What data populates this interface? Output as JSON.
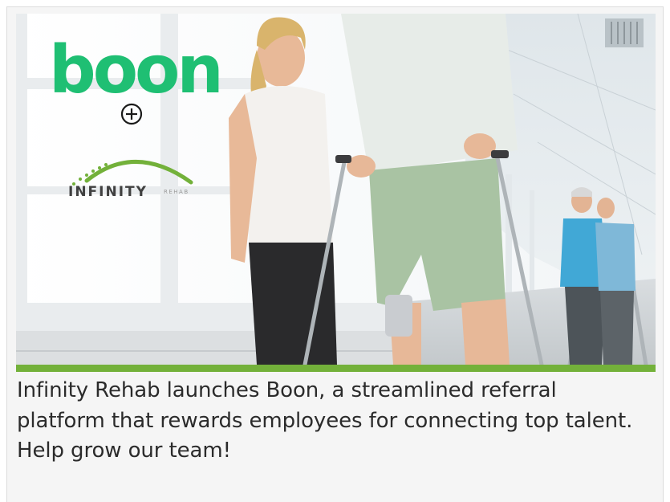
{
  "logo": {
    "brand": "boon",
    "partner_name": "INFINITY",
    "partner_sub": "REHAB"
  },
  "photo": {
    "description_icon": "rehab-walkway-photo"
  },
  "caption": {
    "text": "Infinity Rehab launches Boon, a streamlined referral platform that rewards employees for connecting top talent. Help grow our team!"
  },
  "colors": {
    "brand_green": "#1fbf73",
    "accent_bar": "#73b13a",
    "caption_text": "#2b2b2b",
    "card_bg": "#f5f5f5"
  }
}
